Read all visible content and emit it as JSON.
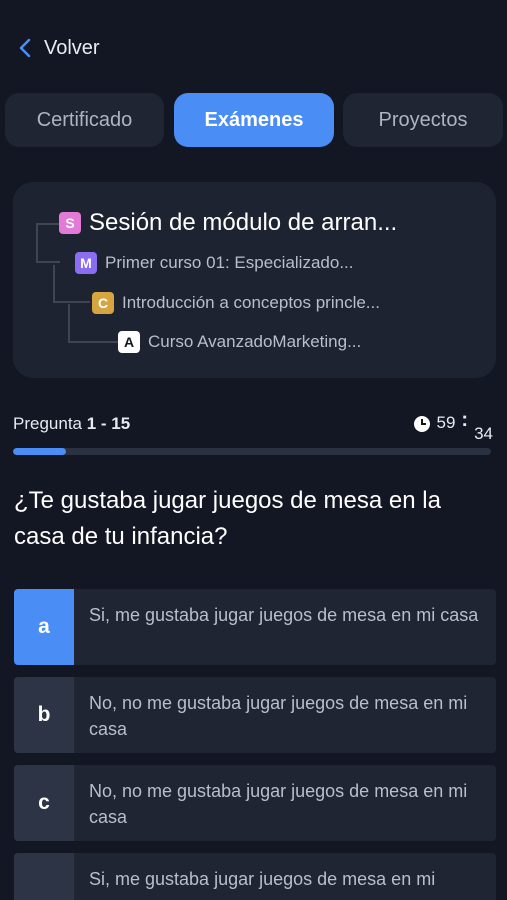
{
  "nav": {
    "back_label": "Volver"
  },
  "tabs": [
    {
      "label": "Certificado",
      "active": false
    },
    {
      "label": "Exámenes",
      "active": true
    },
    {
      "label": "Proyectos",
      "active": false
    }
  ],
  "module_tree": [
    {
      "badge": "S",
      "text": "Sesión de módulo de arran..."
    },
    {
      "badge": "M",
      "text": "Primer curso 01: Especializado..."
    },
    {
      "badge": "C",
      "text": "Introducción a conceptos princle..."
    },
    {
      "badge": "A",
      "text": "Curso AvanzadoMarketing..."
    }
  ],
  "question_header": {
    "label": "Pregunta",
    "range": "1 - 15",
    "timer_minutes": "59",
    "timer_separator": ":",
    "timer_seconds": "34",
    "progress_fraction": 0.11
  },
  "question": {
    "text": "¿Te gustaba jugar juegos de mesa en la casa de tu infancia?"
  },
  "answers": [
    {
      "letter": "a",
      "text": "Si, me gustaba jugar juegos de mesa en mi casa",
      "selected": true
    },
    {
      "letter": "b",
      "text": "No, no me gustaba jugar juegos de mesa en mi casa",
      "selected": false
    },
    {
      "letter": "c",
      "text": "No, no me gustaba jugar juegos de mesa en mi casa",
      "selected": false
    },
    {
      "letter": "",
      "text": "Si, me gustaba jugar juegos de mesa en mi",
      "selected": false
    }
  ],
  "colors": {
    "accent": "#4a8df5",
    "background": "#121723",
    "card": "#1f2533"
  }
}
